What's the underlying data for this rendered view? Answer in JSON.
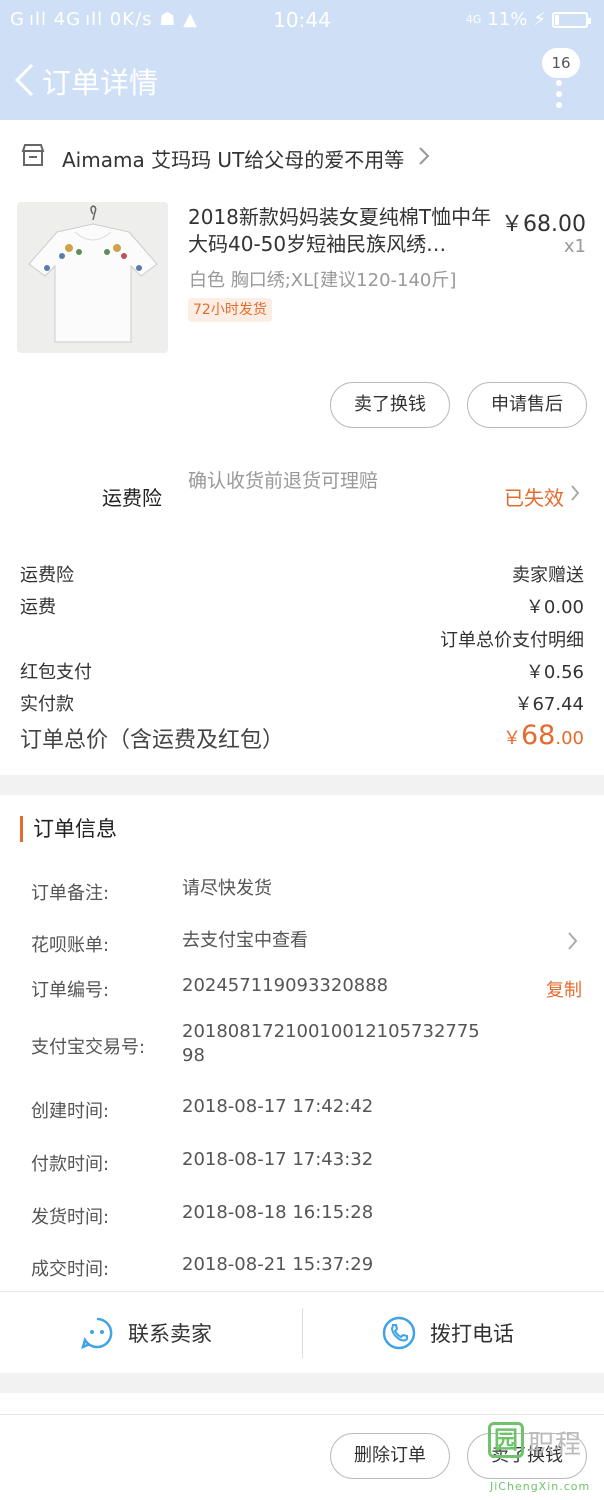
{
  "status_bar": {
    "left": "G ıll 4G ıll 0K/s ☗ ▲",
    "time": "10:44",
    "network": "4G",
    "battery": "11%"
  },
  "nav": {
    "title": "订单详情",
    "badge": "16"
  },
  "shop": {
    "name": "Aimama 艾玛玛 UT给父母的爱不用等"
  },
  "product": {
    "title": "2018新款妈妈装女夏纯棉T恤中年大码40-50岁短袖民族风绣…",
    "price": "￥68.00",
    "qty": "x1",
    "spec": "白色  胸口绣;XL[建议120-140斤]",
    "tag": "72小时发货"
  },
  "actions": {
    "sell": "卖了换钱",
    "after_sale": "申请售后"
  },
  "insurance": {
    "label": "运费险",
    "desc": "确认收货前退货可理赔",
    "status": "已失效"
  },
  "fees": [
    {
      "label": "运费险",
      "value": "卖家赠送"
    },
    {
      "label": "运费",
      "value": "￥0.00"
    }
  ],
  "payment_detail_link": "订单总价支付明细",
  "payments": [
    {
      "label": "红包支付",
      "value": "￥0.56"
    },
    {
      "label": "实付款",
      "value": "￥67.44"
    }
  ],
  "total": {
    "label": "订单总价（含运费及红包）",
    "currency": "￥",
    "int": "68",
    "dec": ".00"
  },
  "order_info": {
    "title": "订单信息",
    "rows": [
      {
        "label": "订单备注:",
        "value": "请尽快发货"
      },
      {
        "label": "花呗账单:",
        "value": "去支付宝中查看"
      },
      {
        "label": "订单编号:",
        "value": "202457119093320888"
      },
      {
        "label": "支付宝交易号:",
        "value": "20180817210010012105732775",
        "value2": "98"
      },
      {
        "label": "创建时间:",
        "value": "2018-08-17 17:42:42"
      },
      {
        "label": "付款时间:",
        "value": "2018-08-17 17:43:32"
      },
      {
        "label": "发货时间:",
        "value": "2018-08-18 16:15:28"
      },
      {
        "label": "成交时间:",
        "value": "2018-08-21 15:37:29"
      }
    ],
    "copy_label": "复制"
  },
  "contact": {
    "seller": "联系卖家",
    "call": "拨打电话"
  },
  "bottom": {
    "delete": "删除订单",
    "sell": "卖了换钱"
  },
  "watermark": {
    "main": "园",
    "text": "职程",
    "sub": "JiChengXin.com"
  },
  "colors": {
    "accent": "#e56b2c",
    "navbar": "#cfe0f6",
    "contact_icon": "#3fa3e6"
  }
}
